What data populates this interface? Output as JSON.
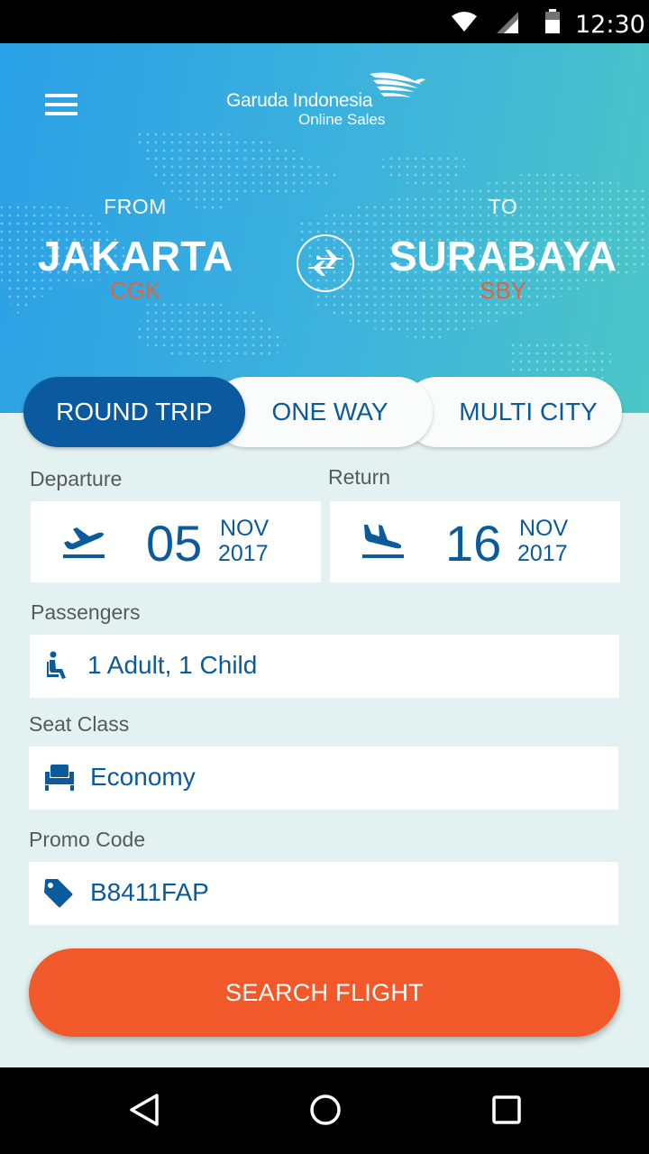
{
  "status_bar": {
    "time": "12:30",
    "icons": [
      "wifi-icon",
      "signal-icon",
      "battery-icon"
    ]
  },
  "header": {
    "menu_icon": "hamburger-menu-icon",
    "logo": {
      "brand": "Garuda Indonesia",
      "sub": "Online Sales",
      "mark": "garuda-bird-logo"
    },
    "from": {
      "label": "FROM",
      "city": "JAKARTA",
      "code": "CGK"
    },
    "to": {
      "label": "TO",
      "city": "SURABAYA",
      "code": "SBY"
    },
    "swap_icon": "swap-plane-icon"
  },
  "trip_tabs": [
    {
      "label": "ROUND TRIP",
      "selected": true
    },
    {
      "label": "ONE WAY",
      "selected": false
    },
    {
      "label": "MULTI CITY",
      "selected": false
    }
  ],
  "form": {
    "departure": {
      "label": "Departure",
      "day": "05",
      "month": "NOV",
      "year": "2017",
      "icon": "takeoff-icon"
    },
    "return": {
      "label": "Return",
      "day": "16",
      "month": "NOV",
      "year": "2017",
      "icon": "landing-icon"
    },
    "passengers": {
      "label": "Passengers",
      "value": "1 Adult, 1 Child",
      "icon": "passenger-icon"
    },
    "seat_class": {
      "label": "Seat Class",
      "value": "Economy",
      "icon": "seat-icon"
    },
    "promo_code": {
      "label": "Promo Code",
      "value": "B8411FAP",
      "icon": "tag-icon"
    }
  },
  "search_button": "SEARCH FLIGHT",
  "colors": {
    "primary_blue": "#0b5a9c",
    "accent_orange": "#f2592a",
    "code_orange": "#e8603a",
    "background": "#e4f1f1"
  },
  "nav_bar": {
    "icons": [
      "back-triangle-icon",
      "home-circle-icon",
      "recents-square-icon"
    ]
  }
}
